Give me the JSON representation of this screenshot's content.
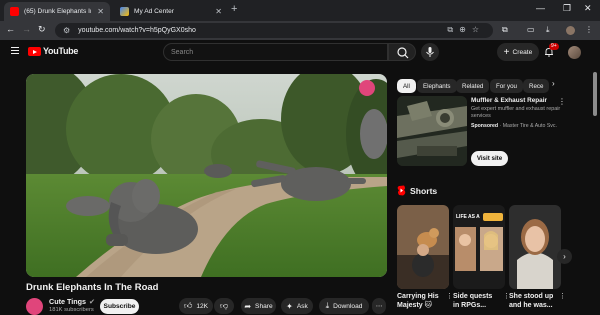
{
  "browser": {
    "tabs": [
      {
        "title": "(65) Drunk Elephants In The Roa",
        "active": true
      },
      {
        "title": "My Ad Center",
        "active": false
      }
    ],
    "url": "youtube.com/watch?v=h5pQyGX0sho"
  },
  "header": {
    "logo_text": "YouTube",
    "search_placeholder": "Search",
    "create_label": "Create",
    "notification_count": "9+"
  },
  "video": {
    "title": "Drunk Elephants In The Road",
    "channel": "Cute Tings",
    "subscribers": "181K subscribers",
    "subscribe_label": "Subscribe",
    "likes": "12K",
    "share_label": "Share",
    "ask_label": "Ask",
    "download_label": "Download"
  },
  "chips": [
    "All",
    "Elephants",
    "Related",
    "For you",
    "Rece"
  ],
  "ad": {
    "title": "Muffler & Exhaust Repair",
    "description": "Get expert muffler and exhaust repair services",
    "sponsored_label": "Sponsored",
    "advertiser": "Master Tire & Auto Svc.",
    "cta": "Visit site"
  },
  "shorts": {
    "title": "Shorts",
    "items": [
      {
        "caption_line1": "Carrying His",
        "caption_line2": "Majesty 🐱"
      },
      {
        "caption_line1": "Side quests",
        "caption_line2": "in RPGs...",
        "thumb_text": "LIFE AS A"
      },
      {
        "caption_line1": "She stood up",
        "caption_line2": "and he was..."
      }
    ]
  },
  "colors": {
    "brand_red": "#ff0000",
    "background": "#0f0f0f",
    "chip": "#272727",
    "channel_pink": "#e0457b"
  }
}
